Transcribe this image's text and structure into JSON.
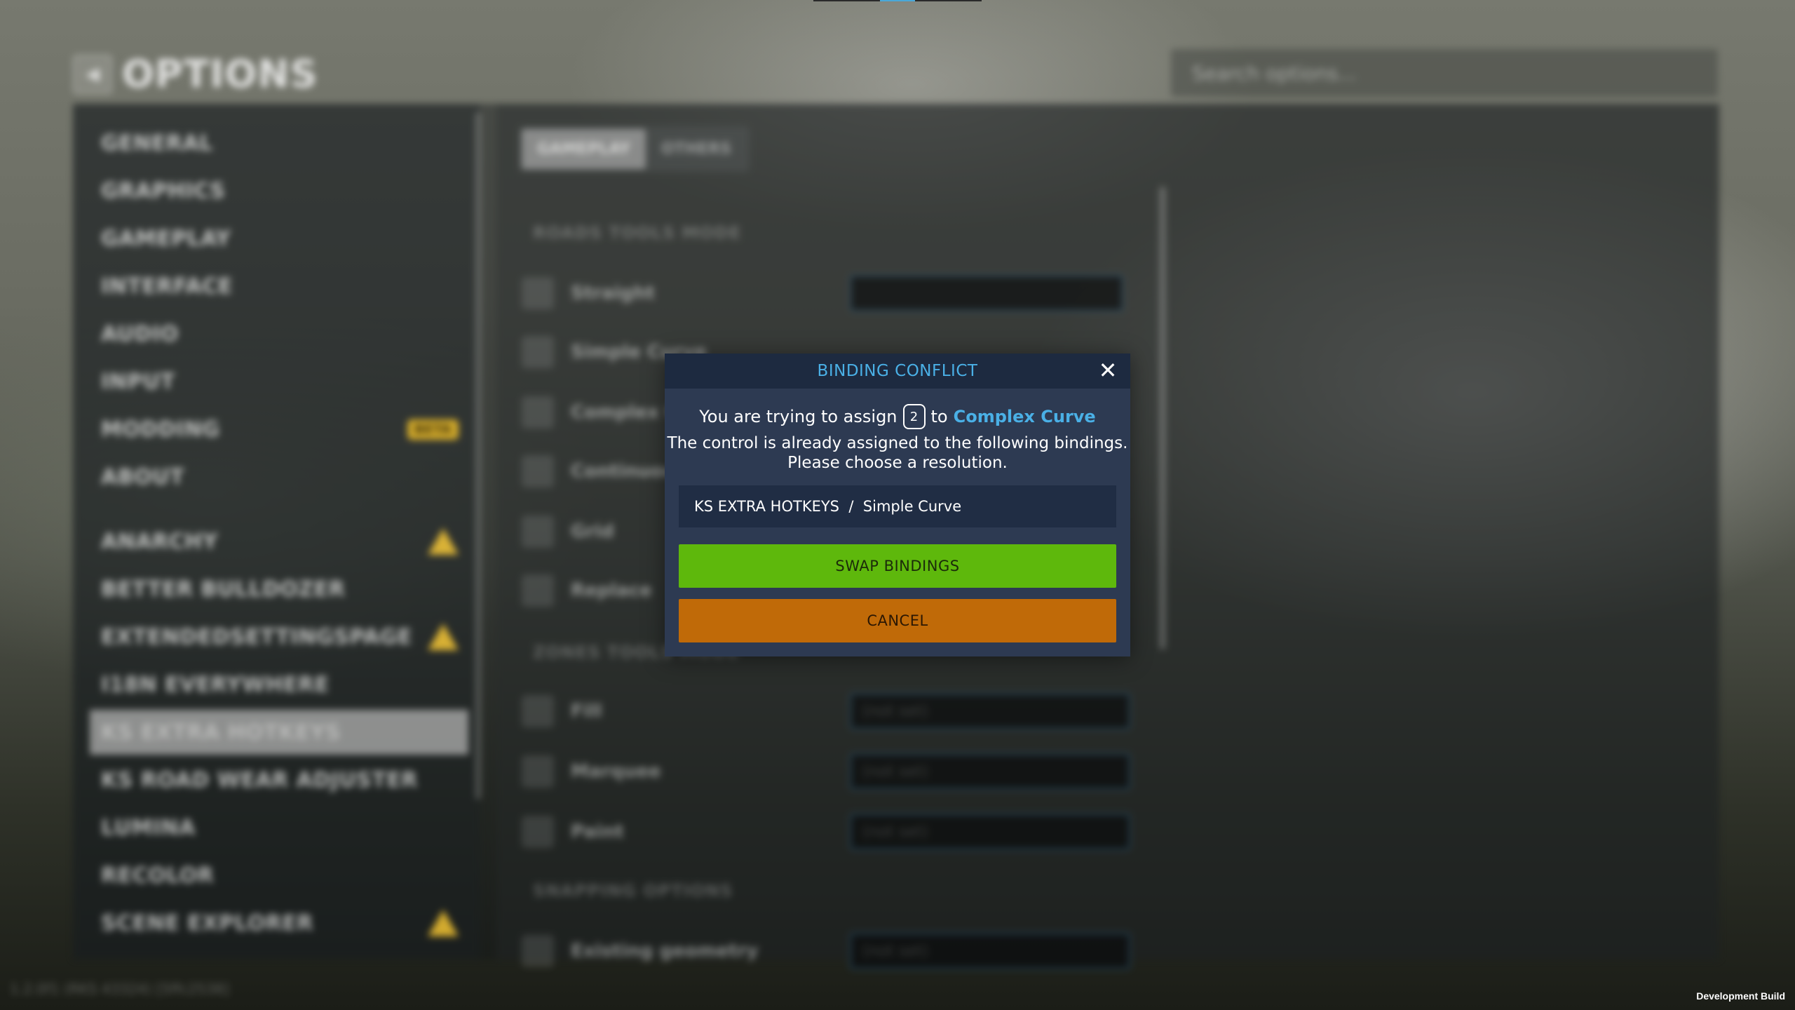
{
  "header": {
    "title": "OPTIONS",
    "back_icon": "back-arrow-icon"
  },
  "search": {
    "placeholder": "Search options..."
  },
  "sidebar": {
    "items": [
      {
        "label": "GENERAL"
      },
      {
        "label": "GRAPHICS"
      },
      {
        "label": "GAMEPLAY"
      },
      {
        "label": "INTERFACE"
      },
      {
        "label": "AUDIO"
      },
      {
        "label": "INPUT"
      },
      {
        "label": "MODDING",
        "badge": "BETA"
      },
      {
        "label": "ABOUT"
      },
      {
        "label": "ANARCHY",
        "warning": true
      },
      {
        "label": "BETTER BULLDOZER"
      },
      {
        "label": "EXTENDEDSETTINGSPAGE",
        "warning": true
      },
      {
        "label": "I18N EVERYWHERE"
      },
      {
        "label": "KS EXTRA HOTKEYS",
        "active": true
      },
      {
        "label": "KS ROAD WEAR ADJUSTER"
      },
      {
        "label": "LUMINA"
      },
      {
        "label": "RECOLOR"
      },
      {
        "label": "SCENE EXPLORER",
        "warning": true
      }
    ]
  },
  "tabs": [
    {
      "label": "GAMEPLAY",
      "active": true
    },
    {
      "label": "OTHERS"
    }
  ],
  "sections": {
    "roads": "ROADS TOOLS MODE",
    "zones": "ZONES TOOLS MODE",
    "snapping": "SNAPPING OPTIONS"
  },
  "rows": [
    {
      "label": "Straight"
    },
    {
      "label": "Simple Curve"
    },
    {
      "label": "Complex Curve"
    },
    {
      "label": "Continuous"
    },
    {
      "label": "Grid"
    },
    {
      "label": "Replace"
    },
    {
      "label": "Fill",
      "binding": "(not set)"
    },
    {
      "label": "Marquee",
      "binding": "(not set)"
    },
    {
      "label": "Paint",
      "binding": "(not set)"
    },
    {
      "label": "Existing geometry",
      "binding": "(not set)"
    }
  ],
  "dialog": {
    "title": "BINDING CONFLICT",
    "line1_prefix": "You are trying to assign",
    "key": "2",
    "line1_to": "to",
    "action": "Complex Curve",
    "line2": "The control is already assigned to the following bindings.",
    "line3": "Please choose a resolution.",
    "conflict": "KS EXTRA HOTKEYS  /  Simple Curve",
    "swap_label": "SWAP BINDINGS",
    "cancel_label": "CANCEL"
  },
  "footer": {
    "version": "1.2.0f1 (RKS 43324) [5ffc2538]",
    "dev_build": "Development Build"
  },
  "colors": {
    "accent": "#4ab0e6",
    "swap": "#5eb80c",
    "cancel": "#c06a08",
    "dialog_bg": "#2d3a52",
    "beta": "#e7b722",
    "warning": "#f1c232"
  }
}
